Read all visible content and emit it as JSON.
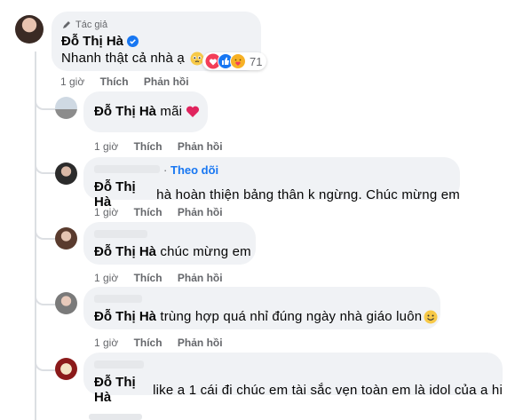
{
  "main_comment": {
    "badge": "Tác giả",
    "author": "Đỗ Thị Hà",
    "text": "Nhanh thật cả nhà ạ",
    "reaction_count": "71",
    "time": "1 giờ",
    "like": "Thích",
    "reply": "Phản hồi"
  },
  "replies": [
    {
      "mention": "Đỗ Thị Hà",
      "text": " mãi",
      "time": "1 giờ",
      "like": "Thích",
      "reply": "Phản hồi"
    },
    {
      "mention": "Đỗ Thị Hà",
      "text": " hà hoàn thiện bảng thân k ngừng. Chúc mừng em",
      "follow": "Theo dõi",
      "time": "1 giờ",
      "like": "Thích",
      "reply": "Phản hồi"
    },
    {
      "mention": "Đỗ Thị Hà",
      "text": " chúc mừng em",
      "time": "1 giờ",
      "like": "Thích",
      "reply": "Phản hồi"
    },
    {
      "mention": "Đỗ Thị Hà",
      "text": " trùng hợp quá nhỉ đúng ngày nhà giáo luôn",
      "time": "1 giờ",
      "like": "Thích",
      "reply": "Phản hồi"
    },
    {
      "mention": "Đỗ Thị Hà",
      "text": " like a 1 cái đi chúc em tài sắc vẹn toàn em là idol của a hi",
      "time": "",
      "like": "",
      "reply": ""
    }
  ],
  "colors": {
    "accent": "#1877f2",
    "bubble": "#f0f2f5",
    "meta": "#65676b",
    "heart": "#f33e58"
  }
}
